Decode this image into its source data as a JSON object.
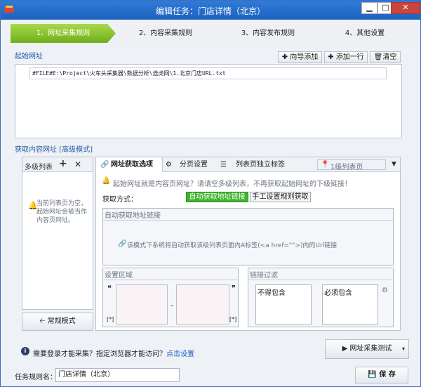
{
  "window": {
    "title": "编辑任务：门店详情（北京）",
    "minimize_glyph": "▁",
    "maximize_glyph": "□",
    "close_glyph": "✕"
  },
  "steps": [
    {
      "label": "1、网址采集规则",
      "active": true
    },
    {
      "label": "2、内容采集规则",
      "active": false
    },
    {
      "label": "3、内容发布规则",
      "active": false
    },
    {
      "label": "4、其他设置",
      "active": false
    }
  ],
  "start_url": {
    "section_label": "起始网址",
    "wizard_add": "向导添加",
    "add_line": "添加一行",
    "clear": "清空",
    "entry": "#FILE#E:\\Project\\火车头采集器\\数据分析\\途虎网\\1.北京门店URL.txt"
  },
  "content_url": {
    "section_label": "获取内容网址 [高级模式]",
    "multi_list": {
      "header": "多级列表",
      "empty_note": "当前列表页为空，起始网址会被当作内容页网址。",
      "normal_mode_button": "常规模式"
    },
    "tabs": [
      {
        "label": "网址获取选项",
        "icon": "link-icon",
        "active": true
      },
      {
        "label": "分页设置",
        "icon": "gears-icon",
        "active": false
      },
      {
        "label": "列表页独立标签",
        "icon": "list-icon",
        "active": false
      }
    ],
    "level_selector": "1级列表页",
    "hint": "起始网址就是内容页网址？请请空多级列表，不再获取起始网址的下级链接！",
    "method_label": "获取方式：",
    "auto_button": "自动获取地址链接",
    "manual_button": "手工设置规则获取",
    "auto_group_label": "自动获取地址链接",
    "auto_group_note": "该模式下系统将自动获取该级列表页面内A标签(<a href=\"\">)内的Url链接",
    "settings_area_label": "设置区域",
    "open_quote": "❝",
    "close_quote": "❞",
    "open_bracket": "[*]",
    "close_bracket": "[*]",
    "dash": "-",
    "link_filter_label": "链接过滤",
    "exclude_label": "不得包含",
    "include_label": "必须包含"
  },
  "footer": {
    "login_question": "需要登录才能采集？指定浏览器才能访问？",
    "click_settings": "点击设置",
    "test_button": "网址采集测试",
    "rule_name_label": "任务规则名：",
    "rule_name_value": "门店详情（北京）",
    "save_button": "保 存"
  }
}
